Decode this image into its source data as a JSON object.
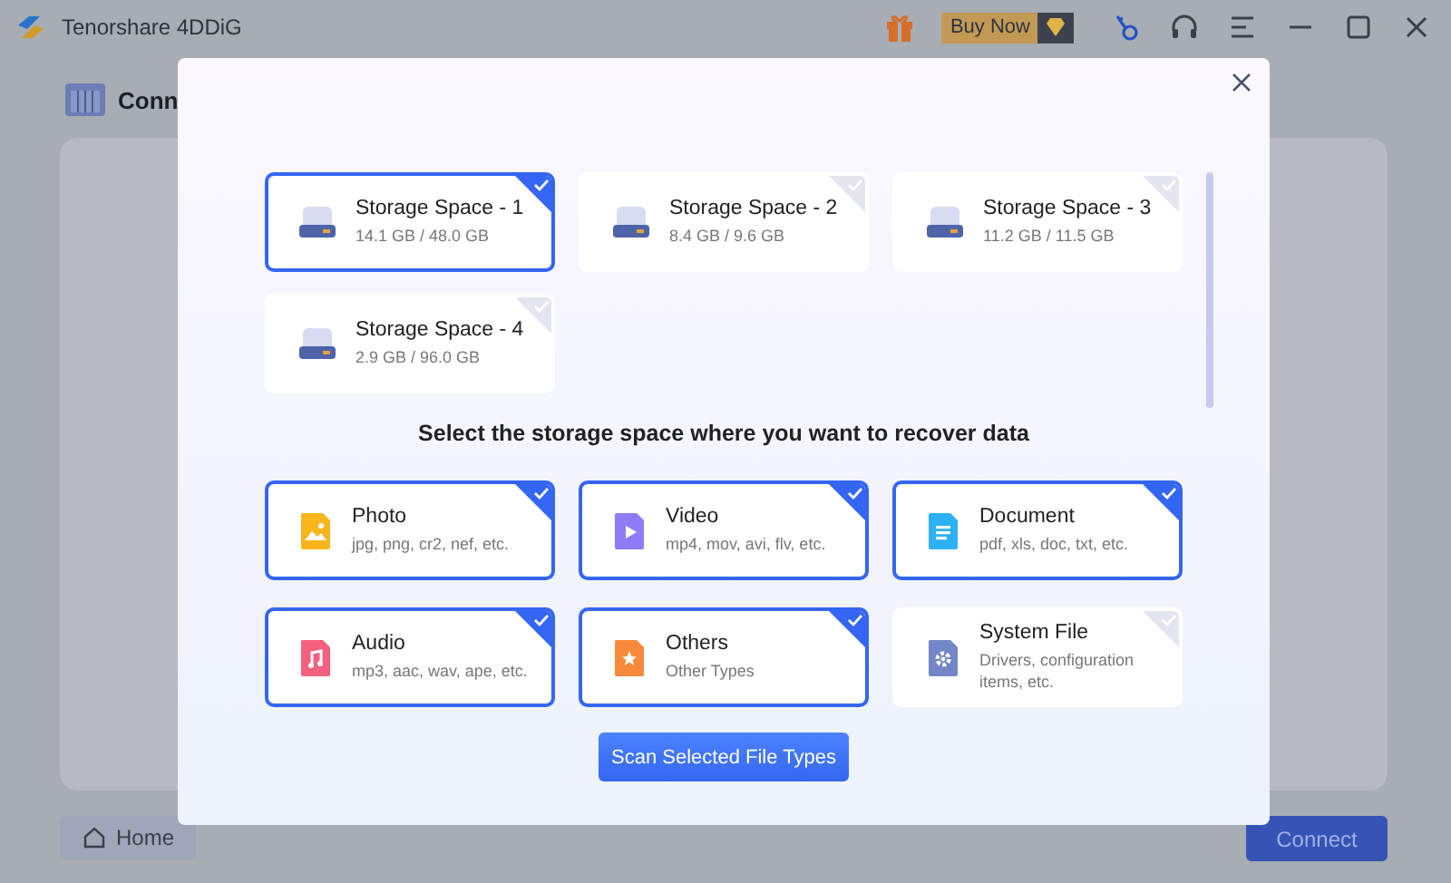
{
  "window": {
    "title": "Tenorshare 4DDiG",
    "buy_button": "Buy Now"
  },
  "page": {
    "heading": "Conn",
    "home_button": "Home",
    "connect_button": "Connect"
  },
  "dialog": {
    "storage_spaces": [
      {
        "name": "Storage Space - 1",
        "usage": "14.1 GB / 48.0 GB",
        "selected": true
      },
      {
        "name": "Storage Space - 2",
        "usage": "8.4 GB / 9.6 GB",
        "selected": false
      },
      {
        "name": "Storage Space - 3",
        "usage": "11.2 GB / 11.5 GB",
        "selected": false
      },
      {
        "name": "Storage Space - 4",
        "usage": "2.9 GB / 96.0 GB",
        "selected": false
      }
    ],
    "prompt": "Select the storage space where you want to recover data",
    "file_types": [
      {
        "kind": "photo",
        "name": "Photo",
        "formats": "jpg, png, cr2, nef, etc.",
        "selected": true
      },
      {
        "kind": "video",
        "name": "Video",
        "formats": "mp4, mov, avi, flv, etc.",
        "selected": true
      },
      {
        "kind": "document",
        "name": "Document",
        "formats": "pdf, xls, doc, txt, etc.",
        "selected": true
      },
      {
        "kind": "audio",
        "name": "Audio",
        "formats": "mp3, aac, wav, ape, etc.",
        "selected": true
      },
      {
        "kind": "others",
        "name": "Others",
        "formats": "Other Types",
        "selected": true
      },
      {
        "kind": "system",
        "name": "System File",
        "formats": "Drivers, configuration items, etc.",
        "selected": false
      }
    ],
    "scan_button": "Scan Selected File Types"
  }
}
